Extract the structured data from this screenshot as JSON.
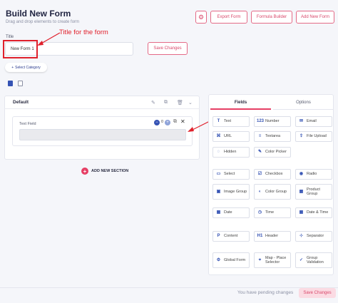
{
  "header": {
    "title": "Build New Form",
    "subtitle": "Drag and drop elements to create form",
    "export_label": "Export Form",
    "formula_label": "Formula Builder",
    "add_label": "Add New Form"
  },
  "form": {
    "title_label": "Title",
    "title_value": "New Form 1",
    "annotation": "Title for the form",
    "save_label": "Save Changes",
    "category_label": "Select Category"
  },
  "section": {
    "name": "Default",
    "field_label": "Text Field",
    "field_count": "0",
    "add_section_label": "ADD NEW SECTION"
  },
  "sidebar": {
    "tab_fields": "Fields",
    "tab_options": "Options",
    "items": [
      {
        "icon": "T",
        "label": "Text"
      },
      {
        "icon": "123",
        "label": "Number"
      },
      {
        "icon": "✉",
        "label": "Email"
      },
      {
        "icon": "⌘",
        "label": "URL"
      },
      {
        "icon": "≡",
        "label": "Textarea"
      },
      {
        "icon": "⇪",
        "label": "File Upload"
      },
      {
        "icon": "◌",
        "label": "Hidden"
      },
      {
        "icon": "✎",
        "label": "Color Picker"
      },
      {
        "icon": "▭",
        "label": "Select"
      },
      {
        "icon": "☑",
        "label": "Checkbox"
      },
      {
        "icon": "◉",
        "label": "Radio"
      },
      {
        "icon": "▣",
        "label": "Image Group"
      },
      {
        "icon": "◐",
        "label": "Color Group"
      },
      {
        "icon": "▦",
        "label": "Product Group"
      },
      {
        "icon": "▦",
        "label": "Date"
      },
      {
        "icon": "◷",
        "label": "Time"
      },
      {
        "icon": "▦",
        "label": "Date & Time"
      },
      {
        "icon": "P",
        "label": "Content"
      },
      {
        "icon": "H1",
        "label": "Header"
      },
      {
        "icon": "⊹",
        "label": "Separator"
      },
      {
        "icon": "⚙",
        "label": "Global Form"
      },
      {
        "icon": "⌖",
        "label": "Map - Place Selector"
      },
      {
        "icon": "✓",
        "label": "Group Validation"
      }
    ]
  },
  "footer": {
    "pending_text": "You have pending changes",
    "save_label": "Save Changes"
  },
  "colors": {
    "accent": "#e63e64",
    "annotation": "#e0212c",
    "icon_blue": "#3553b4"
  }
}
